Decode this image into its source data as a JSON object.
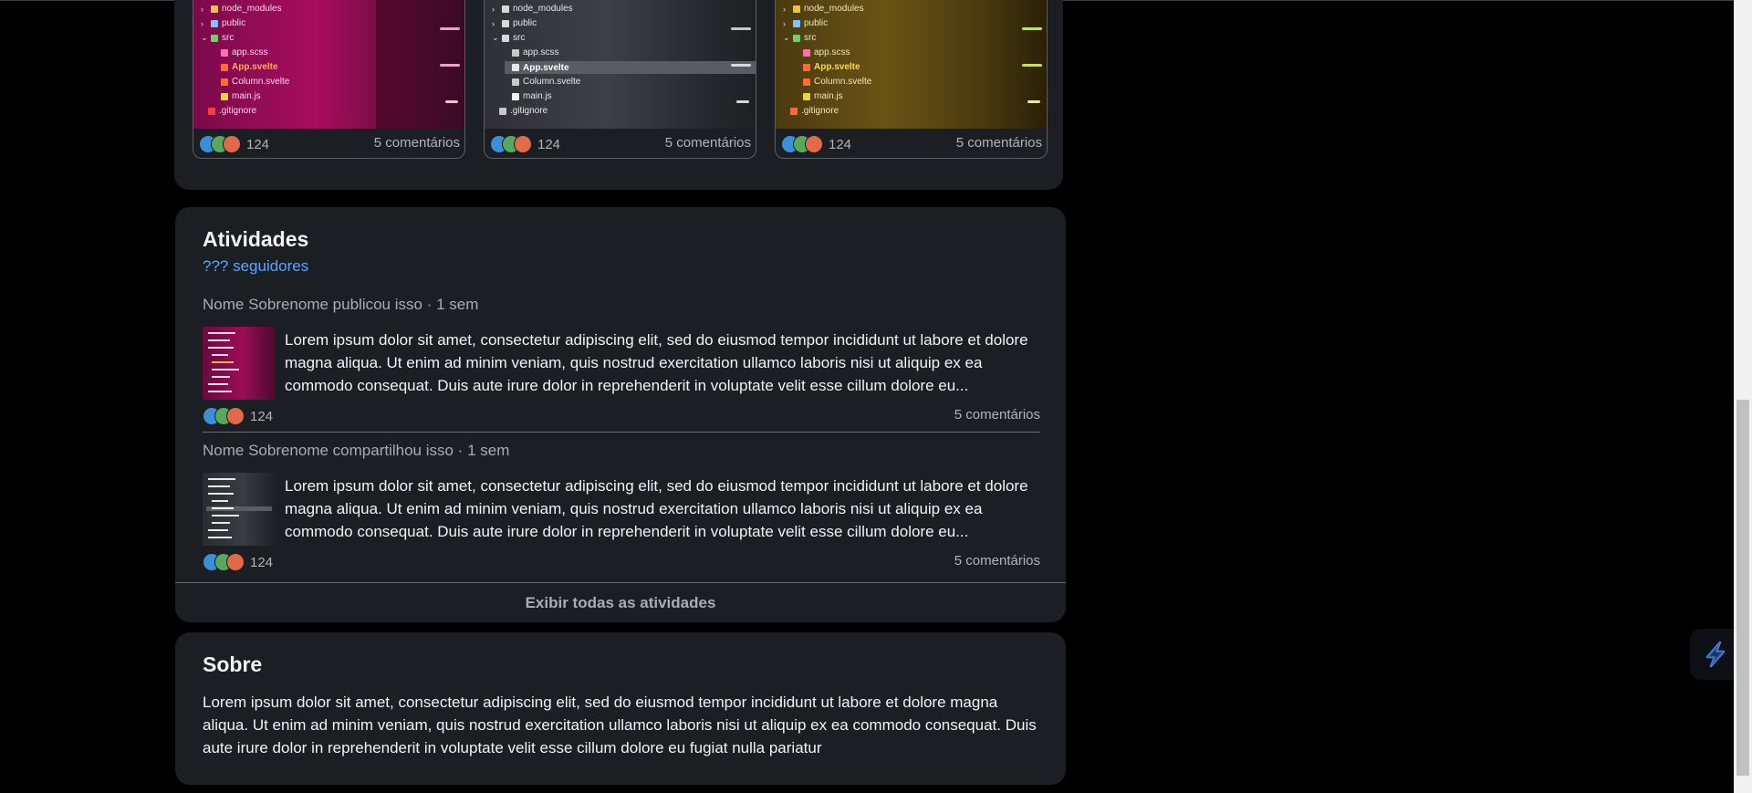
{
  "featured": {
    "tiles": [
      {
        "theme": "magenta",
        "reaction_count": "124",
        "comments": "5 comentários",
        "files": [
          "node_modules",
          "public",
          "src",
          "app.scss",
          "App.svelte",
          "Column.svelte",
          "main.js",
          ".gitignore"
        ]
      },
      {
        "theme": "gray",
        "reaction_count": "124",
        "comments": "5 comentários",
        "files": [
          "node_modules",
          "public",
          "src",
          "app.scss",
          "App.svelte",
          "Column.svelte",
          "main.js",
          ".gitignore"
        ]
      },
      {
        "theme": "olive",
        "reaction_count": "124",
        "comments": "5 comentários",
        "files": [
          "node_modules",
          "public",
          "src",
          "app.scss",
          "App.svelte",
          "Column.svelte",
          "main.js",
          ".gitignore"
        ]
      }
    ]
  },
  "activity": {
    "title": "Atividades",
    "followers": "??? seguidores",
    "items": [
      {
        "meta": "Nome Sobrenome publicou isso · 1 sem",
        "text": "Lorem ipsum dolor sit amet, consectetur adipiscing elit, sed do eiusmod tempor incididunt ut labore et dolore magna aliqua. Ut enim ad minim veniam, quis nostrud exercitation ullamco laboris nisi ut aliquip ex ea commodo consequat. Duis aute irure dolor in reprehenderit in voluptate velit esse cillum dolore eu...",
        "reaction_count": "124",
        "comments": "5 comentários"
      },
      {
        "meta": "Nome Sobrenome compartilhou isso · 1 sem",
        "text": "Lorem ipsum dolor sit amet, consectetur adipiscing elit, sed do eiusmod tempor incididunt ut labore et dolore magna aliqua. Ut enim ad minim veniam, quis nostrud exercitation ullamco laboris nisi ut aliquip ex ea commodo consequat. Duis aute irure dolor in reprehenderit in voluptate velit esse cillum dolore eu...",
        "reaction_count": "124",
        "comments": "5 comentários"
      }
    ],
    "show_all": "Exibir todas as atividades"
  },
  "about": {
    "title": "Sobre",
    "text": "Lorem ipsum dolor sit amet, consectetur adipiscing elit, sed do eiusmod tempor incididunt ut labore et dolore magna aliqua. Ut enim ad minim veniam, quis nostrud exercitation ullamco laboris nisi ut aliquip ex ea commodo consequat. Duis aute irure dolor in reprehenderit in voluptate velit esse cillum dolore eu fugiat nulla pariatur"
  },
  "colors": {
    "card_bg": "#1b1f23",
    "link": "#5aa6ff",
    "reaction_blue": "#3b8fd9",
    "reaction_green": "#56a85a",
    "reaction_red": "#e06a4a"
  },
  "icons": {
    "reactions": [
      "like-reaction-icon",
      "celebrate-reaction-icon",
      "love-reaction-icon"
    ],
    "widget": "lightning-bolt-icon"
  }
}
